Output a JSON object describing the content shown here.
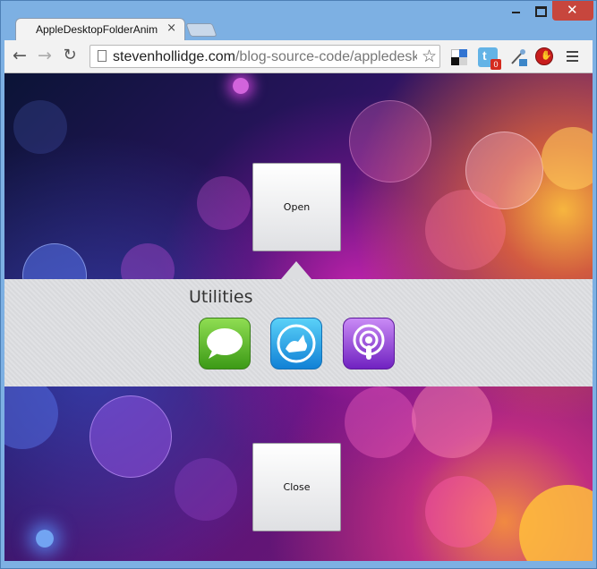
{
  "browser": {
    "tab_title": "AppleDesktopFolderAnim",
    "tab_close": "×",
    "window_controls": {
      "close": "✕"
    },
    "url_host": "stevenhollidge.com",
    "url_path": "/blog-source-code/appledeskto",
    "extensions": [
      {
        "name": "delicious-icon"
      },
      {
        "name": "tweetdeck-icon",
        "badge": "0"
      },
      {
        "name": "dev-tools-icon"
      },
      {
        "name": "adblock-stop-icon"
      }
    ]
  },
  "page": {
    "open_button_label": "Open",
    "close_button_label": "Close",
    "folder": {
      "title": "Utilities",
      "apps": [
        {
          "name": "messages-app-icon"
        },
        {
          "name": "tweetbot-app-icon"
        },
        {
          "name": "podcasts-app-icon"
        }
      ]
    }
  },
  "colors": {
    "panel": "#dcdde0",
    "window_frame": "#7db0e3",
    "close_control": "#c7463d"
  }
}
